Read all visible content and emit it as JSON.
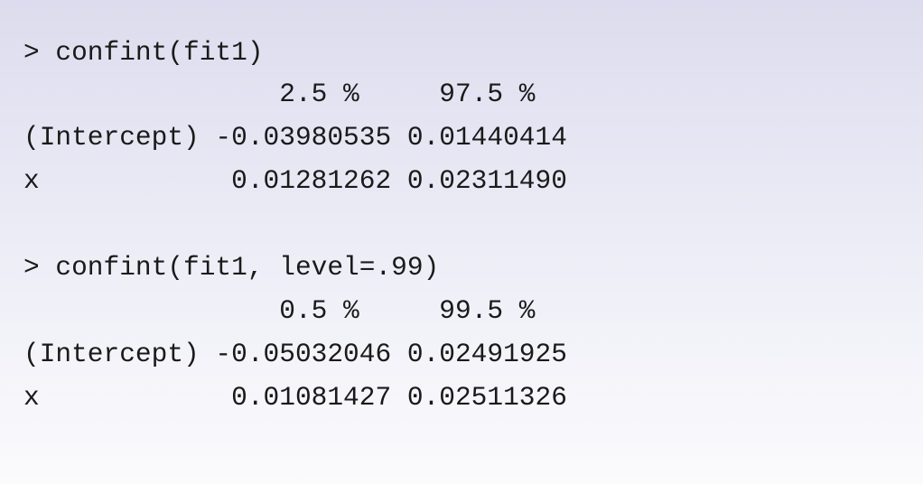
{
  "console": {
    "block1": {
      "command": "> confint(fit1)",
      "header": "                2.5 %     97.5 %",
      "row_intercept": "(Intercept) -0.03980535 0.01440414",
      "row_x": "x            0.01281262 0.02311490"
    },
    "block2": {
      "command": "> confint(fit1, level=.99)",
      "header": "                0.5 %     99.5 %",
      "row_intercept": "(Intercept) -0.05032046 0.02491925",
      "row_x": "x            0.01081427 0.02511326"
    }
  }
}
